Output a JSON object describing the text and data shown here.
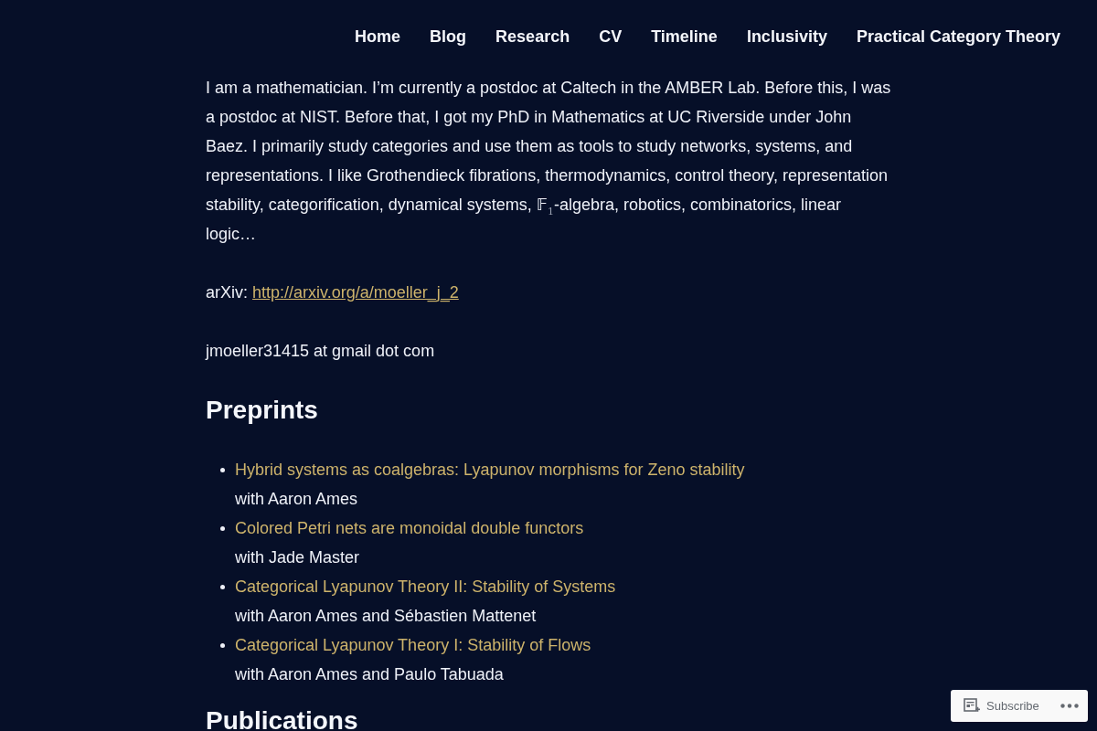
{
  "nav": {
    "items": [
      "Home",
      "Blog",
      "Research",
      "CV",
      "Timeline",
      "Inclusivity",
      "Practical Category Theory"
    ]
  },
  "intro": {
    "paragraph": "I am a mathematician. I’m currently a postdoc at Caltech in the AMBER Lab. Before this, I was a postdoc at NIST. Before that, I got my PhD in Mathematics at UC Riverside under John Baez. I primarily study categories and use them as tools to study networks, systems, and representations. I like Grothendieck fibrations, thermodynamics, control theory, representation stability, categorification, dynamical systems, 𝔽$_{1}$-algebra, robotics, combinatorics, linear logic…",
    "arxiv_label": "arXiv:",
    "arxiv_link": "http://arxiv.org/a/moeller_j_2",
    "email": "jmoeller31415 at gmail dot com"
  },
  "preprints": {
    "heading": "Preprints",
    "items": [
      {
        "title": "Hybrid systems as coalgebras: Lyapunov morphisms for Zeno stability",
        "authors": "with Aaron Ames"
      },
      {
        "title": "Colored Petri nets are monoidal double functors",
        "authors": "with Jade Master"
      },
      {
        "title": "Categorical Lyapunov Theory II: Stability of Systems",
        "authors": "with Aaron Ames and Sébastien Mattenet"
      },
      {
        "title": "Categorical Lyapunov Theory I: Stability of Flows",
        "authors": "with Aaron Ames and Paulo Tabuada"
      }
    ]
  },
  "publications": {
    "heading": "Publications"
  },
  "subscribe_bar": {
    "label": "Subscribe"
  }
}
